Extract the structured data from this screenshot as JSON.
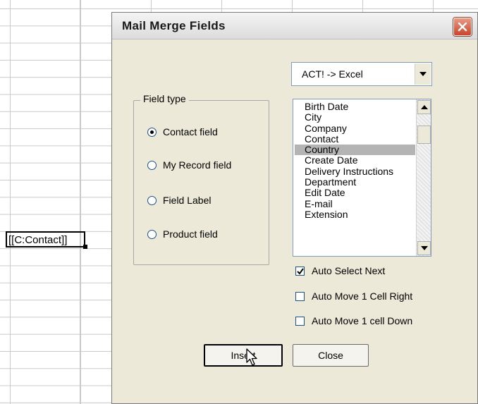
{
  "spreadsheet": {
    "active_cell_text": "[[C:Contact]]"
  },
  "dialog": {
    "title": "Mail Merge Fields",
    "direction_combo": {
      "value": "ACT! -> Excel"
    },
    "field_type_group": {
      "label": "Field type",
      "options": [
        {
          "label": "Contact field",
          "checked": true
        },
        {
          "label": "My Record field",
          "checked": false
        },
        {
          "label": "Field Label",
          "checked": false
        },
        {
          "label": "Product field",
          "checked": false
        }
      ]
    },
    "field_list": {
      "items": [
        "Birth Date",
        "City",
        "Company",
        "Contact",
        "Country",
        "Create Date",
        "Delivery Instructions",
        "Department",
        "Edit Date",
        "E-mail",
        "Extension"
      ],
      "selected": "Country"
    },
    "options": [
      {
        "label": "Auto Select Next",
        "checked": true
      },
      {
        "label": "Auto Move 1 Cell Right",
        "checked": false
      },
      {
        "label": "Auto Move 1 cell Down",
        "checked": false
      }
    ],
    "buttons": {
      "insert": "Insert",
      "close": "Close"
    }
  },
  "colors": {
    "dialog_bg": "#ece9d8",
    "selection": "#b4b4b4",
    "close_button": "#c8452c"
  }
}
